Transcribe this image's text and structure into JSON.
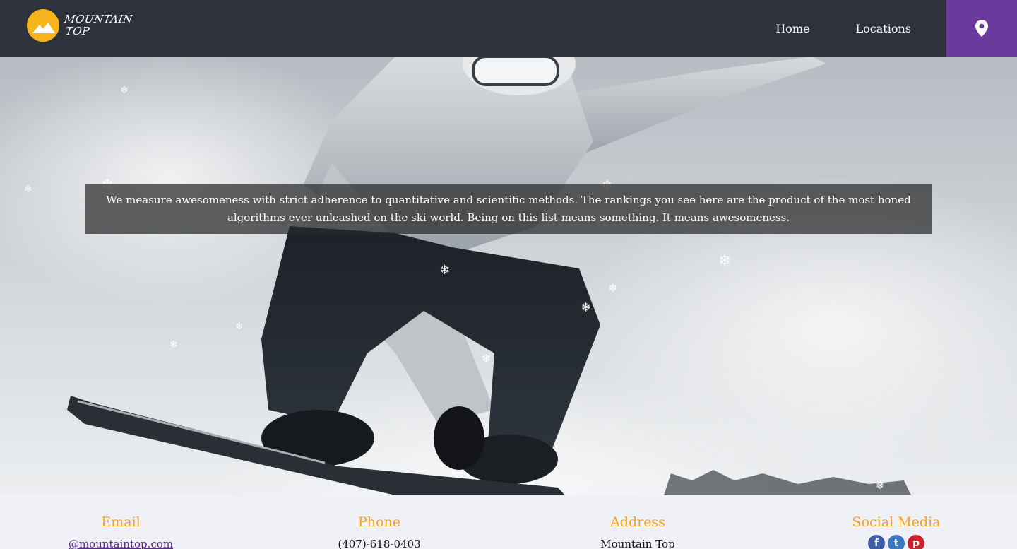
{
  "header": {
    "logo_text_line1": "Mountain",
    "logo_text_line2": "Top",
    "nav": [
      {
        "label": "Home"
      },
      {
        "label": "Locations"
      }
    ],
    "location_button_icon": "map-pin-icon"
  },
  "hero": {
    "caption": "We measure awesomeness with strict adherence to quantitative and scientific methods. The rankings you see here are the product of the most honed algorithms ever unleashed on the ski world. Being on this list means something. It means awesomeness."
  },
  "footer": {
    "email": {
      "heading": "Email",
      "value": "@mountaintop.com"
    },
    "phone": {
      "heading": "Phone",
      "value": "(407)-618-0403"
    },
    "address": {
      "heading": "Address",
      "value": "Mountain Top"
    },
    "social": {
      "heading": "Social Media",
      "icons": [
        "facebook-icon",
        "twitter-icon",
        "pinterest-icon"
      ]
    }
  },
  "colors": {
    "header_bg": "#2e323c",
    "accent_purple": "#6a3a9c",
    "accent_orange": "#f4a41c",
    "logo_yellow": "#f6b51c"
  }
}
